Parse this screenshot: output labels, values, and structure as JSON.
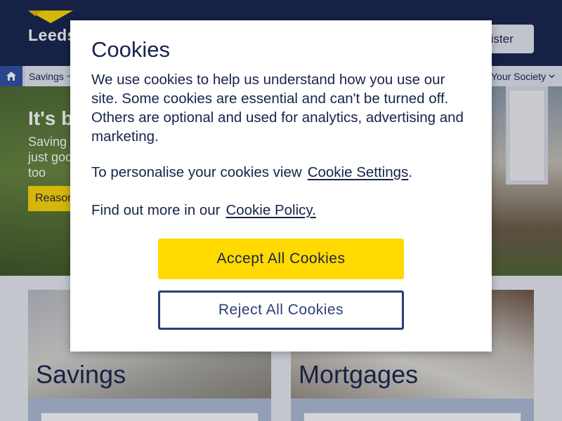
{
  "header": {
    "logo_text": "Leeds",
    "register_label": "gister",
    "brand_color": "#17244a",
    "accent_color": "#ffd900"
  },
  "nav": {
    "home_icon": "home-icon",
    "items": [
      {
        "label": "Savings"
      },
      {
        "label": "Your Society"
      }
    ]
  },
  "hero": {
    "title": "It's b",
    "text": "Saving just goo too",
    "button_label": "Reason"
  },
  "cards": [
    {
      "title": "Savings",
      "select_value": ""
    },
    {
      "title": "Mortgages",
      "select_value": ""
    }
  ],
  "cookie_modal": {
    "title": "Cookies",
    "body": "We use cookies to help us understand how you use our site. Some cookies are essential and can't be turned off. Others are optional and used for analytics, advertising and marketing.",
    "settings_prefix": "To personalise your cookies view",
    "settings_link": "Cookie Settings",
    "settings_suffix": ".",
    "policy_prefix": "Find out more in our",
    "policy_link": "Cookie Policy.",
    "accept_label": "Accept All Cookies",
    "reject_label": "Reject All Cookies"
  }
}
